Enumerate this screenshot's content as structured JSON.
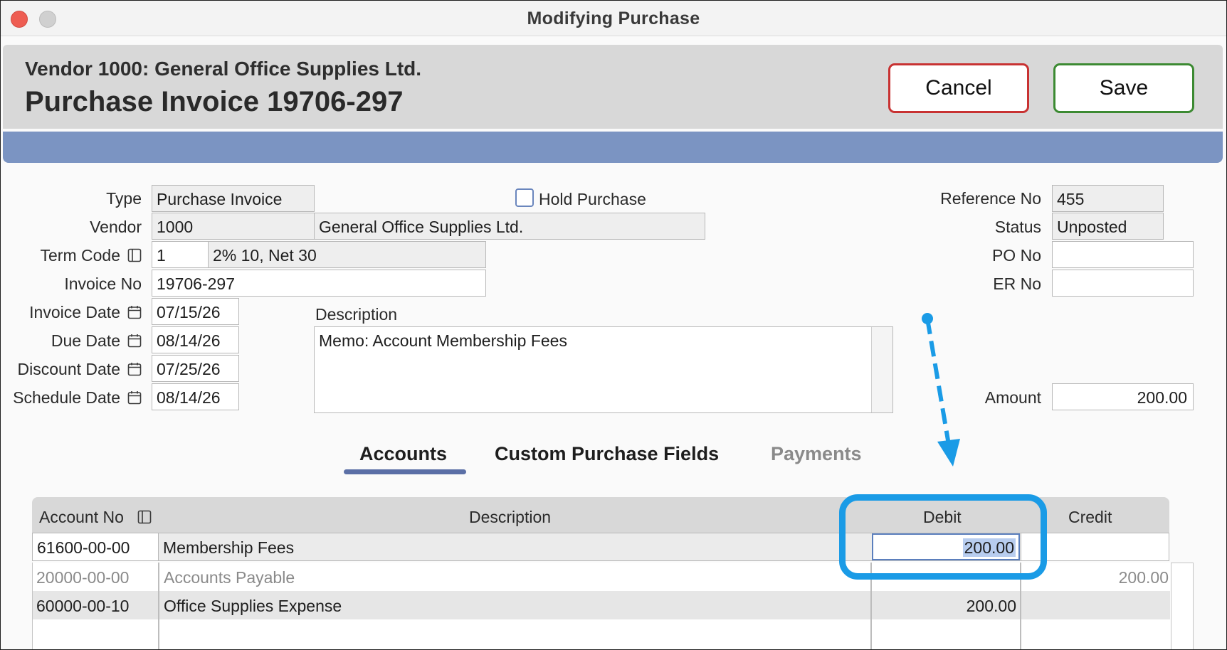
{
  "window": {
    "title": "Modifying Purchase"
  },
  "header": {
    "vendor_line": "Vendor 1000: General Office Supplies Ltd.",
    "doc_title": "Purchase Invoice 19706-297",
    "cancel_label": "Cancel",
    "save_label": "Save"
  },
  "form": {
    "type": {
      "label": "Type",
      "value": "Purchase Invoice"
    },
    "hold": {
      "label": "Hold Purchase",
      "checked": false
    },
    "vendor": {
      "label": "Vendor",
      "code": "1000",
      "name": "General Office Supplies Ltd."
    },
    "term_code": {
      "label": "Term Code",
      "code": "1",
      "description": "2% 10, Net 30"
    },
    "invoice_no": {
      "label": "Invoice No",
      "value": "19706-297"
    },
    "invoice_date": {
      "label": "Invoice Date",
      "value": "07/15/26"
    },
    "due_date": {
      "label": "Due Date",
      "value": "08/14/26"
    },
    "discount_date": {
      "label": "Discount Date",
      "value": "07/25/26"
    },
    "schedule_date": {
      "label": "Schedule Date",
      "value": "08/14/26"
    },
    "description": {
      "label": "Description",
      "value": "Memo: Account Membership Fees"
    },
    "reference_no": {
      "label": "Reference No",
      "value": "455"
    },
    "status": {
      "label": "Status",
      "value": "Unposted"
    },
    "po_no": {
      "label": "PO No",
      "value": ""
    },
    "er_no": {
      "label": "ER No",
      "value": ""
    },
    "amount": {
      "label": "Amount",
      "value": "200.00"
    }
  },
  "tabs": [
    {
      "label": "Accounts",
      "active": true
    },
    {
      "label": "Custom Purchase Fields",
      "active": false
    },
    {
      "label": "Payments",
      "active": false,
      "disabled": true
    }
  ],
  "grid": {
    "columns": [
      "Account No",
      "Description",
      "Debit",
      "Credit"
    ],
    "edit_row": {
      "account": "61600-00-00",
      "description": "Membership Fees",
      "debit": "200.00",
      "credit": ""
    },
    "rows": [
      {
        "account": "20000-00-00",
        "description": "Accounts Payable",
        "debit": "",
        "credit": "200.00",
        "dimmed": true
      },
      {
        "account": "60000-00-10",
        "description": "Office Supplies Expense",
        "debit": "200.00",
        "credit": ""
      }
    ]
  },
  "icons": {
    "term_code": "lookup-list-icon",
    "dates": "calendar-icon",
    "account_no": "lookup-list-icon"
  },
  "colors": {
    "accent_band": "#7b94c2",
    "cancel_border": "#c83232",
    "save_border": "#3c8a32",
    "callout": "#1a9be6",
    "tab_underline": "#5b6fa6"
  }
}
